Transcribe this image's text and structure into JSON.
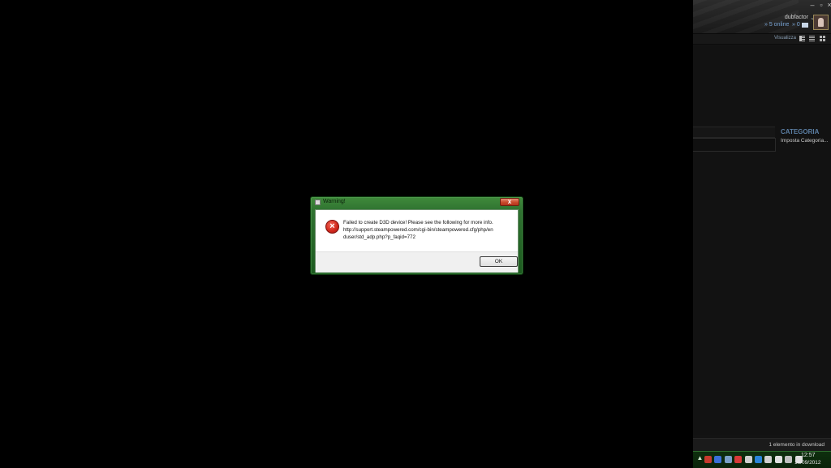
{
  "steam": {
    "window_controls": {
      "minimize": "–",
      "maximize": "▫",
      "close": "×"
    },
    "username": "dubfactor",
    "friends_online": "» 5 online",
    "messages_count": "» 0",
    "view_label": "Visualizza",
    "category": {
      "heading": "CATEGORIA",
      "set_link": "Imposta Categoria..."
    },
    "download_status": "1 elemento in download"
  },
  "taskbar": {
    "chevron": "▲",
    "tray_icons": [
      {
        "name": "usb-icon",
        "color": "#c83a2e"
      },
      {
        "name": "bluetooth-icon",
        "color": "#3a6fd8"
      },
      {
        "name": "network-share-icon",
        "color": "#7aa0c8"
      },
      {
        "name": "antivirus-icon",
        "color": "#d83a3a"
      },
      {
        "name": "steam-tray-icon",
        "color": "#cfcfcf"
      },
      {
        "name": "update-icon",
        "color": "#2a84d8"
      },
      {
        "name": "gear-tray-icon",
        "color": "#d0d0d0"
      },
      {
        "name": "flag-icon",
        "color": "#e0e0e0"
      },
      {
        "name": "display-icon",
        "color": "#c0c0c0"
      },
      {
        "name": "volume-icon",
        "color": "#e0e0e0"
      }
    ],
    "time": "12:57",
    "date": "16/09/2012"
  },
  "dialog": {
    "title": "Warning!",
    "close_label": "x",
    "error_icon": "×",
    "message_lines": [
      "Failed to create D3D device! Please see the following for more info.",
      "http://support.steampowered.com/cgi-bin/steampowered.cfg/php/en",
      "duser/std_adp.php?p_faqid=772"
    ],
    "ok_label": "OK"
  }
}
